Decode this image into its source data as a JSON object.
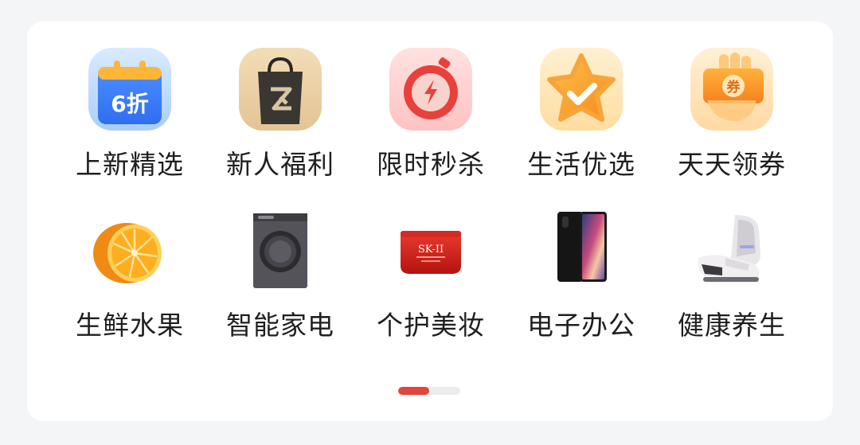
{
  "menu": {
    "row1": [
      {
        "label": "上新精选",
        "icon": "calendar-discount-icon",
        "badge": "6折"
      },
      {
        "label": "新人福利",
        "icon": "shopping-bag-icon",
        "badge": ""
      },
      {
        "label": "限时秒杀",
        "icon": "flash-timer-icon",
        "badge": ""
      },
      {
        "label": "生活优选",
        "icon": "star-check-icon",
        "badge": ""
      },
      {
        "label": "天天领券",
        "icon": "coupon-hand-icon",
        "badge": "券"
      }
    ],
    "row2": [
      {
        "label": "生鲜水果",
        "icon": "orange-icon"
      },
      {
        "label": "智能家电",
        "icon": "washing-machine-icon"
      },
      {
        "label": "个护美妆",
        "icon": "cream-jar-icon",
        "badge": "SK-II"
      },
      {
        "label": "电子办公",
        "icon": "smartphone-icon"
      },
      {
        "label": "健康养生",
        "icon": "massage-chair-icon"
      }
    ]
  },
  "pager": {
    "page": 1,
    "pages": 2,
    "progress": 0.5
  },
  "colors": {
    "accent": "#e0463b",
    "background": "#f4f5f7",
    "card": "#ffffff",
    "text": "#1f1f1f"
  }
}
